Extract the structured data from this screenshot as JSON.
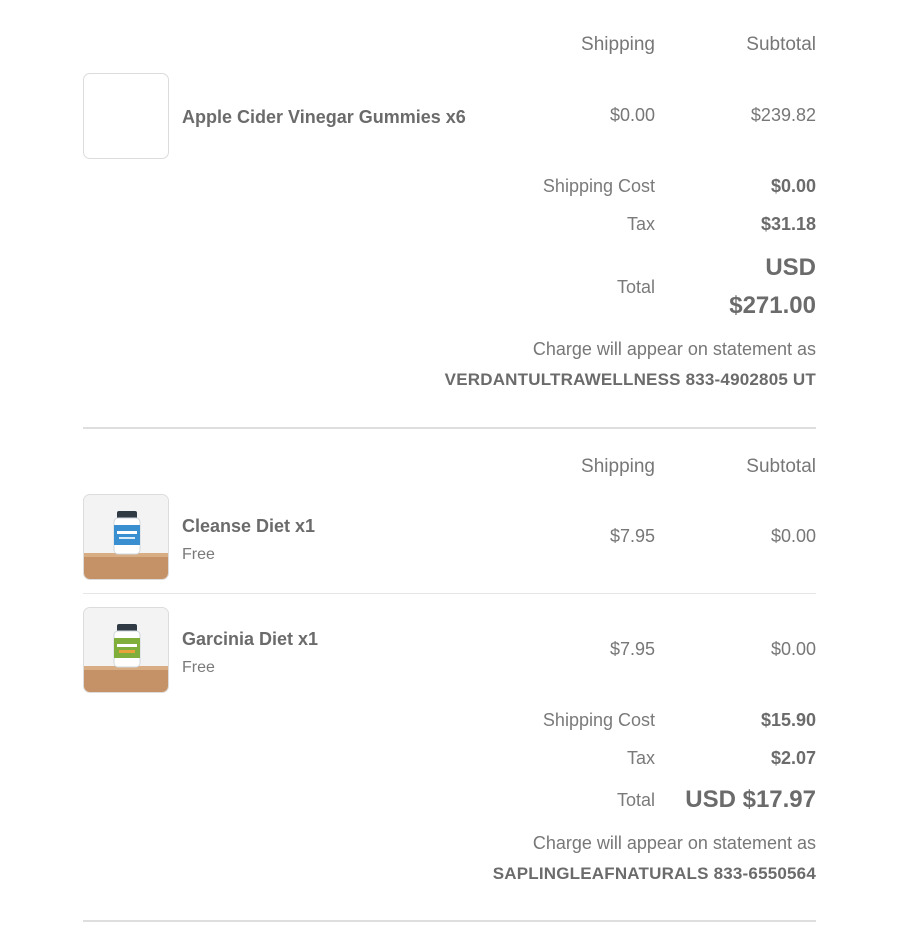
{
  "orders": [
    {
      "headers": {
        "shipping": "Shipping",
        "subtotal": "Subtotal"
      },
      "items": [
        {
          "name": "Apple Cider Vinegar Gummies x6",
          "shipping": "$0.00",
          "subtotal": "$239.82"
        }
      ],
      "summary": {
        "shipping_cost_label": "Shipping Cost",
        "shipping_cost": "$0.00",
        "tax_label": "Tax",
        "tax": "$31.18",
        "total_label": "Total",
        "total_currency": "USD",
        "total_amount": "$271.00"
      },
      "statement_note": "Charge will appear on statement as",
      "statement_descriptor": "VERDANTULTRAWELLNESS 833-4902805 UT"
    },
    {
      "headers": {
        "shipping": "Shipping",
        "subtotal": "Subtotal"
      },
      "items": [
        {
          "name": "Cleanse Diet x1",
          "sub": "Free",
          "shipping": "$7.95",
          "subtotal": "$0.00",
          "bottle_color": "#3a8fd0",
          "bottle_text": "CLEANSE"
        },
        {
          "name": "Garcinia Diet x1",
          "sub": "Free",
          "shipping": "$7.95",
          "subtotal": "$0.00",
          "bottle_color": "#7fae3a",
          "bottle_text": "GARCINIA"
        }
      ],
      "summary": {
        "shipping_cost_label": "Shipping Cost",
        "shipping_cost": "$15.90",
        "tax_label": "Tax",
        "tax": "$2.07",
        "total_label": "Total",
        "total": "USD $17.97"
      },
      "statement_note": "Charge will appear on statement as",
      "statement_descriptor": "SAPLINGLEAFNATURALS 833-6550564"
    }
  ]
}
